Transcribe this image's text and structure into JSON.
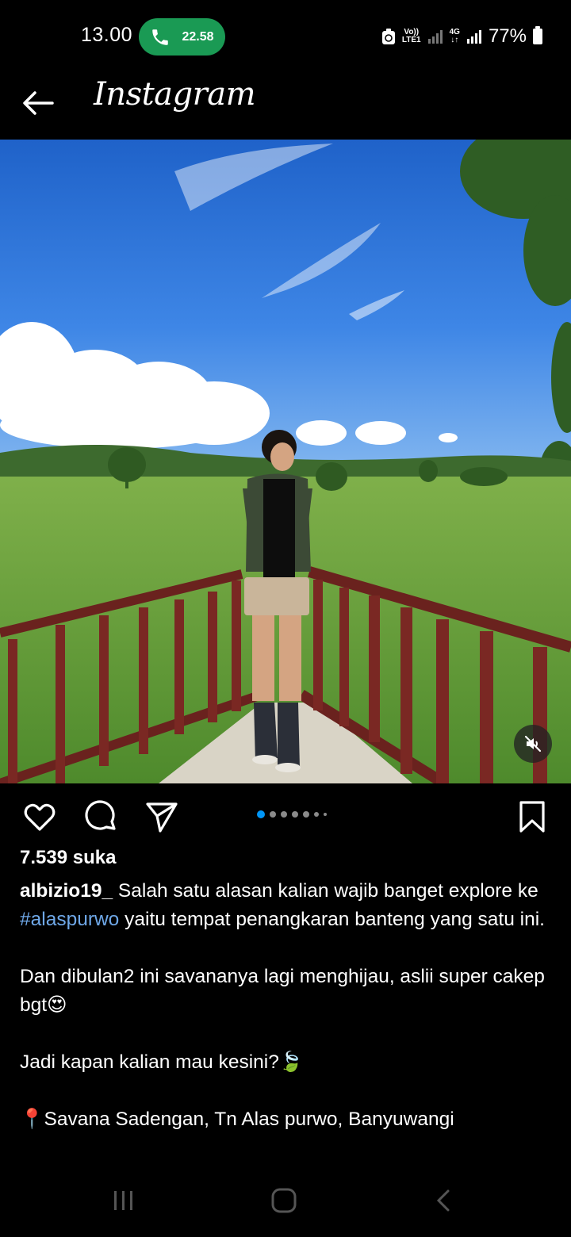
{
  "status_bar": {
    "time": "13.00",
    "call_timer": "22.58",
    "network_1": "Vo)) LTE1",
    "network_2": "4G",
    "battery": "77%"
  },
  "header": {
    "app_name": "Instagram"
  },
  "post": {
    "likes": "7.539 suka",
    "username": "albizio19_",
    "caption_line1": " Salah satu alasan kalian wajib banget explore ke ",
    "hashtag": "#alaspurwo",
    "caption_line1_end": " yaitu tempat penangkaran banteng yang satu ini.",
    "paragraph2": "Dan dibulan2 ini savananya lagi menghijau, aslii super cakep bgt😍",
    "paragraph3": "Jadi kapan kalian mau kesini?🍃",
    "location": "📍Savana Sadengan, Tn Alas purwo, Banyuwangi",
    "carousel_total": 7,
    "carousel_current": 1
  },
  "icons": {
    "back": "back-arrow-icon",
    "like": "heart-icon",
    "comment": "comment-icon",
    "share": "paper-plane-icon",
    "save": "bookmark-icon",
    "mute": "speaker-muted-icon"
  },
  "colors": {
    "accent": "#0095f6",
    "call": "#1a9a54",
    "hashtag": "#6fa8e8"
  }
}
